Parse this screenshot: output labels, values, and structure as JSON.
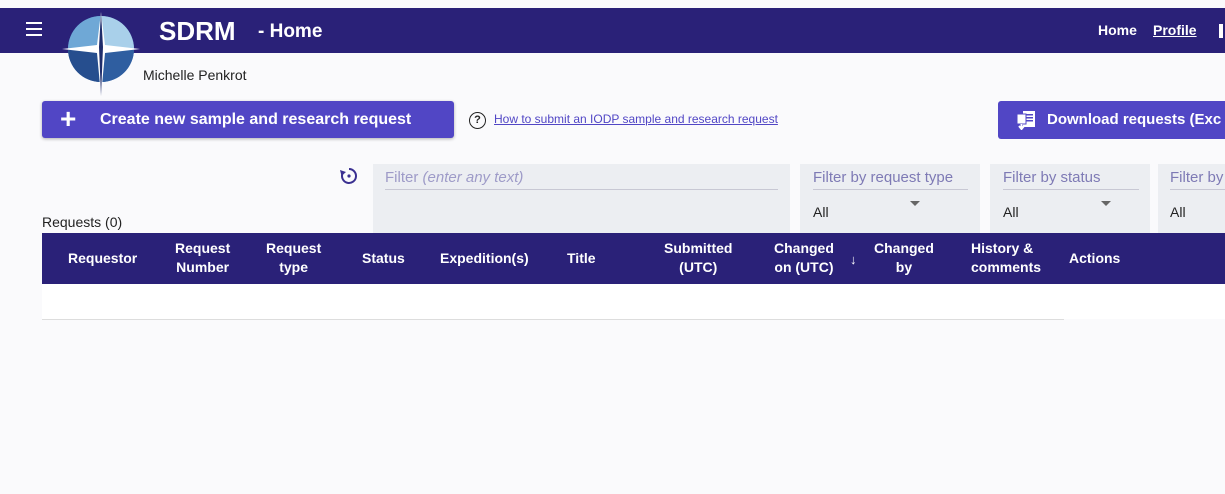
{
  "header": {
    "app_title": "SDRM",
    "page_title": "- Home",
    "nav": {
      "home": "Home",
      "profile": "Profile"
    }
  },
  "user": {
    "name": "Michelle Penkrot"
  },
  "actions": {
    "create_label": "Create new sample and research request",
    "help_link": "How to submit an IODP sample and research request",
    "download_label": "Download requests (Exc"
  },
  "filters": {
    "text": {
      "label": "Filter",
      "hint": "(enter any text)"
    },
    "request_type": {
      "label": "Filter by request type",
      "value": "All"
    },
    "status": {
      "label": "Filter by status",
      "value": "All"
    },
    "more": {
      "label": "Filter by",
      "value": "All"
    }
  },
  "table": {
    "count_label": "Requests (0)",
    "columns": {
      "requestor": "Requestor",
      "request_number_1": "Request",
      "request_number_2": "Number",
      "request_type_1": "Request",
      "request_type_2": "type",
      "status": "Status",
      "expeditions": "Expedition(s)",
      "title": "Title",
      "submitted_1": "Submitted",
      "submitted_2": "(UTC)",
      "changed_on_1": "Changed",
      "changed_on_2": "on (UTC)",
      "changed_by_1": "Changed",
      "changed_by_2": "by",
      "history_1": "History &",
      "history_2": "comments",
      "actions": "Actions"
    },
    "sort_indicator": "↓"
  },
  "colors": {
    "brand": "#2a2178",
    "accent": "#5146c5"
  }
}
